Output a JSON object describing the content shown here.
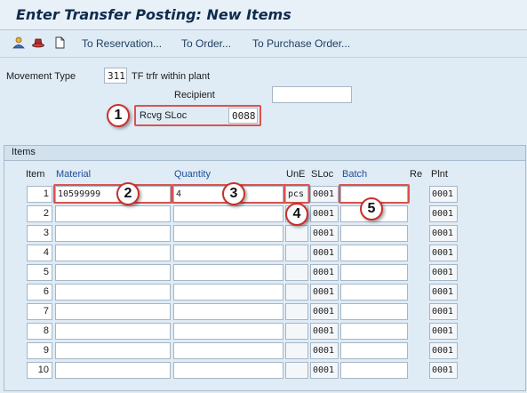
{
  "title": "Enter Transfer Posting: New Items",
  "toolbar": {
    "icons": [
      "person-icon",
      "hat-icon",
      "document-icon"
    ],
    "buttons": [
      "To Reservation...",
      "To Order...",
      "To Purchase Order..."
    ]
  },
  "form": {
    "movement_type_label": "Movement Type",
    "movement_type_value": "311",
    "movement_type_desc": "TF trfr within plant",
    "recipient_label": "Recipient",
    "recipient_value": "",
    "rcvg_sloc_label": "Rcvg SLoc",
    "rcvg_sloc_value": "0088"
  },
  "items": {
    "title": "Items",
    "headers": {
      "item": "Item",
      "material": "Material",
      "quantity": "Quantity",
      "une": "UnE",
      "sloc": "SLoc",
      "batch": "Batch",
      "re": "Re",
      "plnt": "Plnt"
    },
    "rows": [
      {
        "no": "1",
        "material": "10599999",
        "quantity": "4",
        "une": "pcs",
        "sloc": "0001",
        "batch": "",
        "plnt": "0001"
      },
      {
        "no": "2",
        "material": "",
        "quantity": "",
        "une": "",
        "sloc": "0001",
        "batch": "",
        "plnt": "0001"
      },
      {
        "no": "3",
        "material": "",
        "quantity": "",
        "une": "",
        "sloc": "0001",
        "batch": "",
        "plnt": "0001"
      },
      {
        "no": "4",
        "material": "",
        "quantity": "",
        "une": "",
        "sloc": "0001",
        "batch": "",
        "plnt": "0001"
      },
      {
        "no": "5",
        "material": "",
        "quantity": "",
        "une": "",
        "sloc": "0001",
        "batch": "",
        "plnt": "0001"
      },
      {
        "no": "6",
        "material": "",
        "quantity": "",
        "une": "",
        "sloc": "0001",
        "batch": "",
        "plnt": "0001"
      },
      {
        "no": "7",
        "material": "",
        "quantity": "",
        "une": "",
        "sloc": "0001",
        "batch": "",
        "plnt": "0001"
      },
      {
        "no": "8",
        "material": "",
        "quantity": "",
        "une": "",
        "sloc": "0001",
        "batch": "",
        "plnt": "0001"
      },
      {
        "no": "9",
        "material": "",
        "quantity": "",
        "une": "",
        "sloc": "0001",
        "batch": "",
        "plnt": "0001"
      },
      {
        "no": "10",
        "material": "",
        "quantity": "",
        "une": "",
        "sloc": "0001",
        "batch": "",
        "plnt": "0001"
      }
    ]
  },
  "callouts": [
    "1",
    "2",
    "3",
    "4",
    "5"
  ],
  "colors": {
    "callout_border": "#c9302c",
    "highlight": "#d9534f",
    "header_text": "#1f4e99"
  }
}
